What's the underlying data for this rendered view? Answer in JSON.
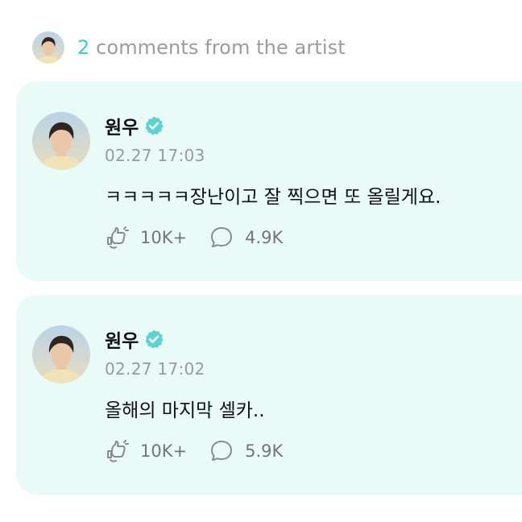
{
  "header": {
    "count": "2",
    "label": "comments from the artist",
    "avatar_icon": "artist-avatar"
  },
  "colors": {
    "accent": "#3fc9c7",
    "card_background": "#e9faf7",
    "verified_badge": "#5cd3d0",
    "muted_text": "#9a9a9a"
  },
  "comments": [
    {
      "author": "원우",
      "verified_icon": "verified-check-icon",
      "timestamp": "02.27 17:03",
      "text": "ㅋㅋㅋㅋㅋ장난이고 잘 찍으면 또 올릴게요.",
      "likes": "10K+",
      "replies": "4.9K",
      "like_icon": "like-hand-icon",
      "reply_icon": "speech-bubble-icon"
    },
    {
      "author": "원우",
      "verified_icon": "verified-check-icon",
      "timestamp": "02.27 17:02",
      "text": "올해의 마지막 셀카..",
      "likes": "10K+",
      "replies": "5.9K",
      "like_icon": "like-hand-icon",
      "reply_icon": "speech-bubble-icon"
    }
  ]
}
